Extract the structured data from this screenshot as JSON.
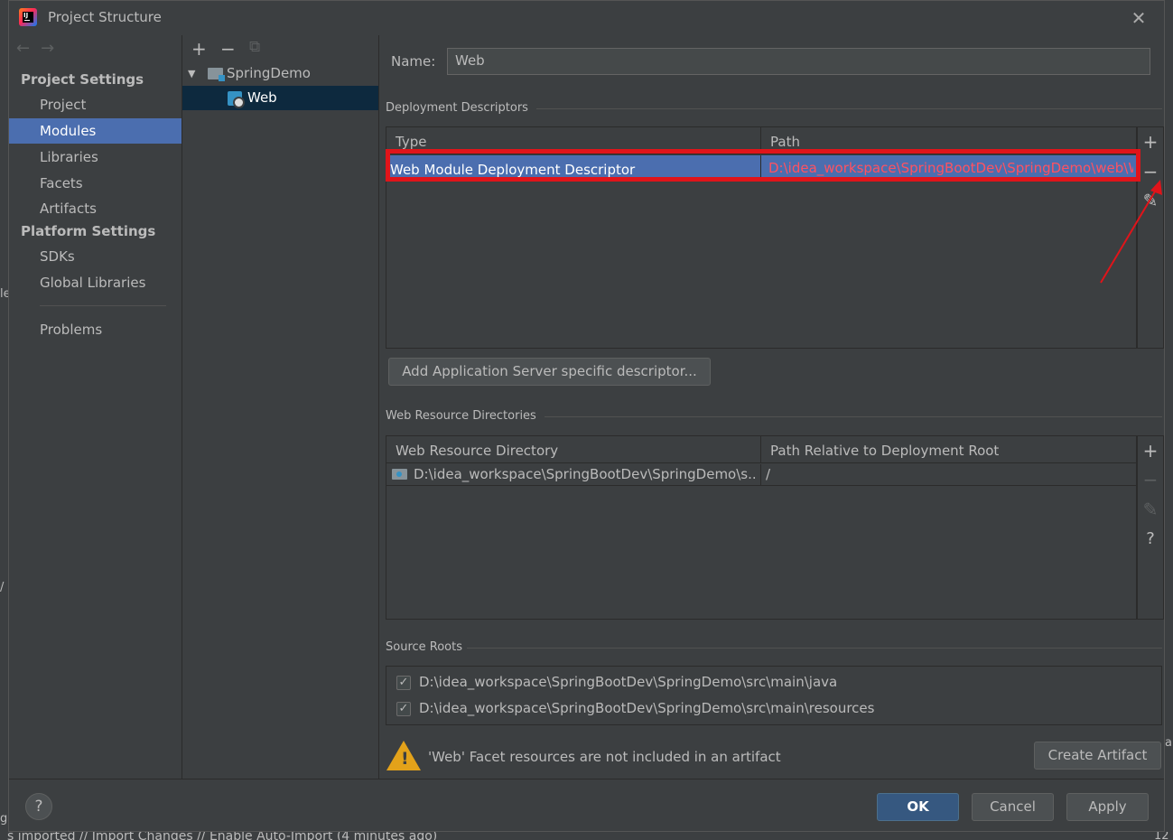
{
  "window": {
    "title": "Project Structure",
    "close_label": "✕"
  },
  "background": {
    "status_text": "s imported // Import Changes // Enable Auto-Import (4 minutes ago)",
    "status_right": "12",
    "frag_le": "le",
    "frag_slash": "/",
    "frag_a": "a",
    "frag_gs": "gs"
  },
  "nav": {
    "back_label": "←",
    "forward_label": "→",
    "project_settings_heading": "Project Settings",
    "platform_settings_heading": "Platform Settings",
    "items": [
      {
        "label": "Project"
      },
      {
        "label": "Modules"
      },
      {
        "label": "Libraries"
      },
      {
        "label": "Facets"
      },
      {
        "label": "Artifacts"
      },
      {
        "label": "SDKs"
      },
      {
        "label": "Global Libraries"
      },
      {
        "label": "Problems"
      }
    ],
    "selected": "Modules"
  },
  "tree": {
    "add_label": "+",
    "remove_label": "−",
    "copy_label": "⧉",
    "expand_label": "▼",
    "root": "SpringDemo",
    "child": "Web"
  },
  "main": {
    "name_label": "Name:",
    "name_value": "Web",
    "deployment_section": "Deployment Descriptors",
    "deployment_table": {
      "headers": [
        "Type",
        "Path"
      ],
      "row": {
        "type": "Web Module Deployment Descriptor",
        "path": "D:\\idea_workspace\\SpringBootDev\\SpringDemo\\web\\WEB-INF\\web.xml"
      }
    },
    "add_descriptor_button": "Add Application Server specific descriptor...",
    "web_resource_section": "Web Resource Directories",
    "web_resource_table": {
      "headers": [
        "Web Resource Directory",
        "Path Relative to Deployment Root"
      ],
      "row": {
        "directory": "D:\\idea_workspace\\SpringBootDev\\SpringDemo\\s...",
        "relative_path": "/"
      }
    },
    "source_roots_section": "Source Roots",
    "source_roots": [
      {
        "path": "D:\\idea_workspace\\SpringBootDev\\SpringDemo\\src\\main\\java",
        "checked": true
      },
      {
        "path": "D:\\idea_workspace\\SpringBootDev\\SpringDemo\\src\\main\\resources",
        "checked": true
      }
    ],
    "warning_text": "'Web' Facet resources are not included in an artifact",
    "create_artifact_button": "Create Artifact",
    "tools": {
      "add": "+",
      "remove": "−",
      "edit": "✎",
      "help": "?",
      "check": "✓"
    }
  },
  "footer": {
    "help_label": "?",
    "ok_label": "OK",
    "cancel_label": "Cancel",
    "apply_label": "Apply"
  },
  "colors": {
    "selection": "#4b6eaf",
    "tree_selection": "#0d293e",
    "error_path": "#ff5261",
    "highlight_box": "#e0141a",
    "warning": "#e3a21a"
  }
}
